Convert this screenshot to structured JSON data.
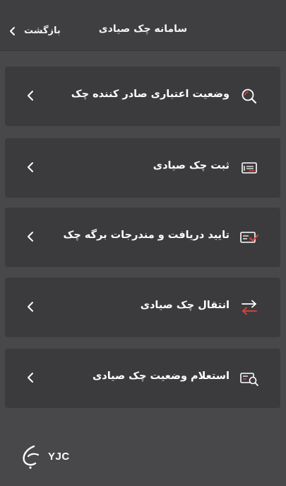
{
  "header": {
    "title": "سامانه چک صیادی",
    "back_label": "بازگشت"
  },
  "menu": {
    "items": [
      {
        "label": "وضعیت اعتباری صادر کننده چک",
        "icon": "magnifier-icon"
      },
      {
        "label": "ثبت چک صیادی",
        "icon": "cheque-register-icon"
      },
      {
        "label": "تایید دریافت و مندرجات برگه چک",
        "icon": "cheque-confirm-icon"
      },
      {
        "label": "انتقال چک صیادی",
        "icon": "transfer-arrows-icon"
      },
      {
        "label": "استعلام وضعیت چک صیادی",
        "icon": "cheque-inquiry-icon"
      }
    ]
  },
  "watermark": {
    "text": "YJC"
  },
  "colors": {
    "background": "#48484b",
    "card": "#3b3b3e",
    "topbar": "#3f3f42",
    "accent_red": "#e0443a"
  }
}
